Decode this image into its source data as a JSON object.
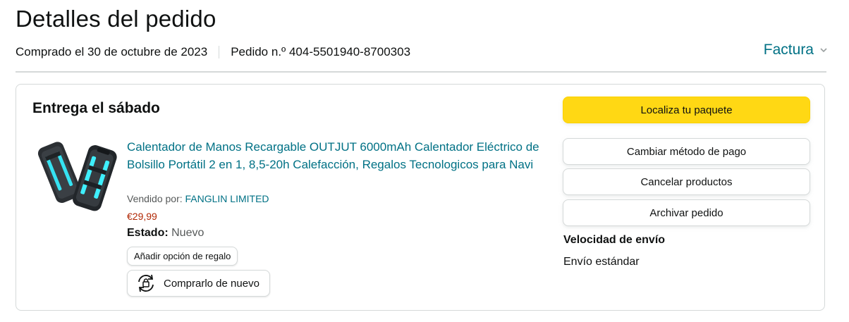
{
  "header": {
    "title": "Detalles del pedido",
    "purchase_date": "Comprado el 30 de octubre de 2023",
    "order_number": "Pedido n.º 404-5501940-8700303",
    "invoice_label": "Factura"
  },
  "shipment": {
    "delivery_title": "Entrega el sábado",
    "product": {
      "title": "Calentador de Manos Recargable OUTJUT 6000mAh Calentador Eléctrico de Bolsillo Portátil 2 en 1, 8,5-20h Calefacción, Regalos Tecnologicos para Navi",
      "seller_prefix": "Vendido por:",
      "seller_name": "FANGLIN LIMITED",
      "price": "€29,99",
      "condition_label": "Estado:",
      "condition_value": "Nuevo",
      "image_icon": "hand-warmer-product-image"
    },
    "gift_button_label": "Añadir opción de regalo",
    "rebuy_button_label": "Comprarlo de nuevo",
    "rebuy_icon": "rebuy-cycle-icon"
  },
  "actions": {
    "track_label": "Localiza tu paquete",
    "change_payment_label": "Cambiar método de pago",
    "cancel_label": "Cancelar productos",
    "archive_label": "Archivar pedido"
  },
  "shipping": {
    "speed_label": "Velocidad de envío",
    "speed_value": "Envío estándar"
  },
  "colors": {
    "link": "#007185",
    "price": "#b12704",
    "primary_button": "#ffd814",
    "border": "#d5d9d9",
    "text": "#0f1111"
  }
}
